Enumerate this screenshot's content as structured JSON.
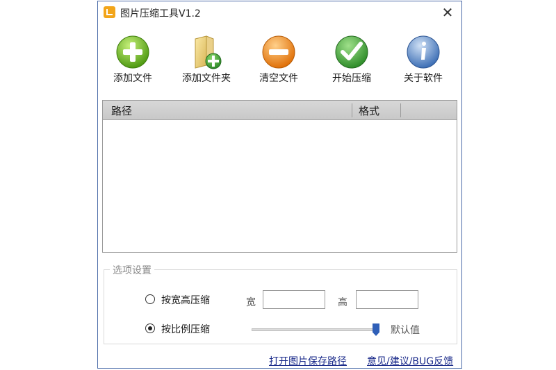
{
  "window": {
    "title": "图片压缩工具V1.2",
    "close_glyph": "✕"
  },
  "toolbar": {
    "items": [
      {
        "label": "添加文件",
        "icon": "add-circle-icon"
      },
      {
        "label": "添加文件夹",
        "icon": "add-folder-icon"
      },
      {
        "label": "清空文件",
        "icon": "clear-circle-icon"
      },
      {
        "label": "开始压缩",
        "icon": "check-circle-icon"
      },
      {
        "label": "关于软件",
        "icon": "info-circle-icon"
      }
    ]
  },
  "filelist": {
    "columns": [
      "路径",
      "格式"
    ]
  },
  "options": {
    "legend": "选项设置",
    "by_size": {
      "label": "按宽高压缩",
      "selected": false,
      "width_label": "宽",
      "height_label": "高",
      "width_value": "",
      "height_value": ""
    },
    "by_ratio": {
      "label": "按比例压缩",
      "selected": true,
      "slider_value_label": "默认值",
      "slider_level": 1.0
    }
  },
  "links": {
    "open_path": "打开图片保存路径",
    "feedback": "意见/建议/BUG反馈"
  },
  "colors": {
    "green": "#6fbf26",
    "orange": "#f08a10",
    "blue_info": "#5a8fd0",
    "slider_thumb": "#2f5fb8",
    "link": "#1a2a8a"
  }
}
